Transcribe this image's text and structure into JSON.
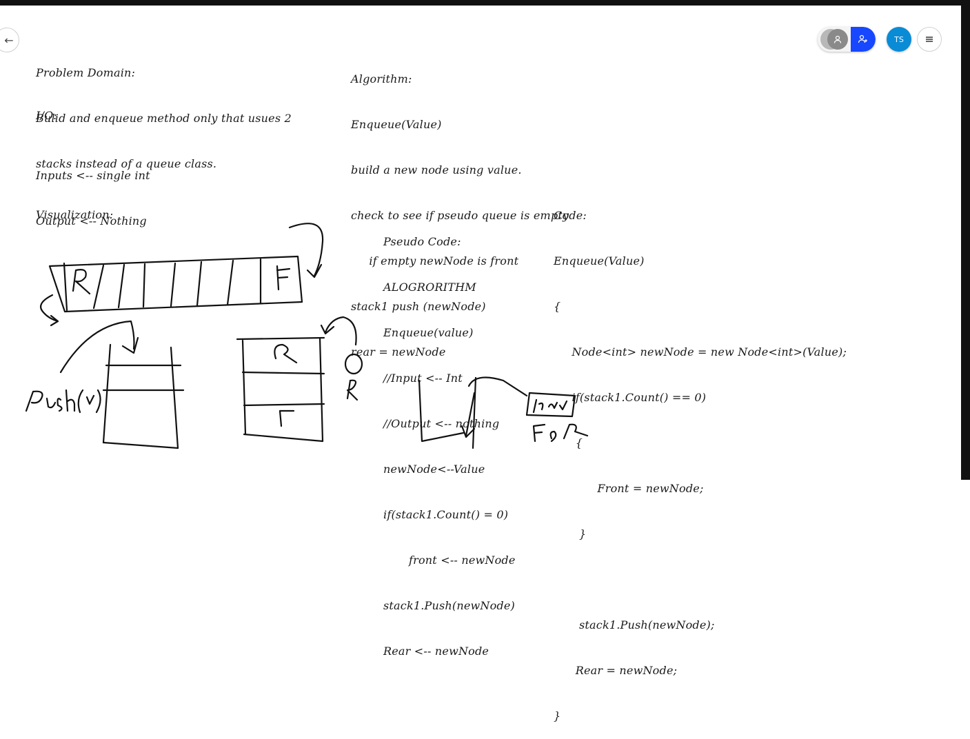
{
  "toolbar": {
    "avatar_initials": "TS",
    "accent_color": "#1747ff",
    "avatar_color": "#0a8bd6",
    "icons": [
      "arrow-left-icon",
      "user-icon",
      "add-user-icon",
      "hamburger-menu-icon"
    ]
  },
  "problem_domain": [
    "Problem Domain:",
    "Bulid and enqueue method only that usues 2",
    "stacks instead of a queue class."
  ],
  "io": {
    "heading": "I/O:",
    "lines": [
      "Inputs <-- single int",
      "Output <-- Nothing"
    ]
  },
  "visualization": {
    "heading": "Visualization:",
    "push_label": "Push(v)",
    "queue_rear_label": "R",
    "queue_front_label": "F",
    "stack_top_label": "R",
    "stack_bottom_label": "F",
    "side_label": "R",
    "node_label": "New",
    "fr_label": "F & R"
  },
  "algorithm": [
    "Algorithm:",
    "Enqueue(Value)",
    "build a new node using value.",
    "check to see if pseudo queue is empty",
    "     if empty newNode is front",
    "stack1 push (newNode)",
    "rear = newNode"
  ],
  "pseudo_code": [
    "Pseudo Code:",
    "ALOGRORITHM",
    "Enqueue(value)",
    "//Input <-- Int",
    "//Output <-- nothing",
    "newNode<--Value",
    "if(stack1.Count() = 0)",
    "       front <-- newNode",
    "stack1.Push(newNode)",
    "Rear <-- newNode"
  ],
  "code": [
    "Code:",
    "Enqueue(Value)",
    "{",
    "     Node<int> newNode = new Node<int>(Value);",
    "     if(stack1.Count() == 0)",
    "      {",
    "            Front = newNode;",
    "       }",
    "",
    "       stack1.Push(newNode);",
    "      Rear = newNode;",
    "}"
  ]
}
